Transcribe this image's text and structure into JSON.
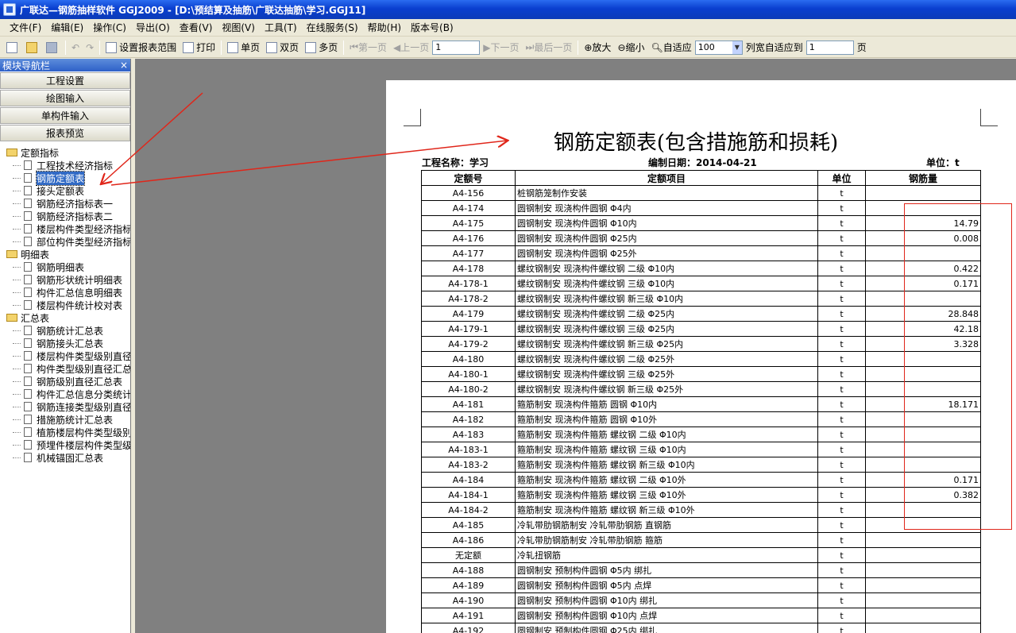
{
  "window": {
    "title": "广联达—钢筋抽样软件 GGJ2009 - [D:\\预结算及抽筋\\广联达抽筋\\学习.GGJ11]"
  },
  "menu": [
    "文件(F)",
    "编辑(E)",
    "操作(C)",
    "导出(O)",
    "查看(V)",
    "视图(V)",
    "工具(T)",
    "在线服务(S)",
    "帮助(H)",
    "版本号(B)"
  ],
  "toolbar": {
    "set_range": "设置报表范围",
    "print": "打印",
    "single_page": "单页",
    "double_page": "双页",
    "multi_page": "多页",
    "first_page": "第一页",
    "prev_page": "上一页",
    "page_value": "1",
    "next_page": "下一页",
    "last_page": "最后一页",
    "zoom_in": "放大",
    "zoom_out": "缩小",
    "fit": "自适应",
    "zoom_value": "100",
    "col_fit": "列宽自适应到",
    "col_fit_value": "1",
    "page_unit": "页"
  },
  "nav": {
    "header": "模块导航栏",
    "close": "×",
    "buttons": [
      "工程设置",
      "绘图输入",
      "单构件输入",
      "报表预览"
    ],
    "folders": [
      {
        "label": "定额指标",
        "items": [
          "工程技术经济指标",
          "钢筋定额表",
          "接头定额表",
          "钢筋经济指标表一",
          "钢筋经济指标表二",
          "楼层构件类型经济指标",
          "部位构件类型经济指标"
        ]
      },
      {
        "label": "明细表",
        "items": [
          "钢筋明细表",
          "钢筋形状统计明细表",
          "构件汇总信息明细表",
          "楼层构件统计校对表"
        ]
      },
      {
        "label": "汇总表",
        "items": [
          "钢筋统计汇总表",
          "钢筋接头汇总表",
          "楼层构件类型级别直径",
          "构件类型级别直径汇总",
          "钢筋级别直径汇总表",
          "构件汇总信息分类统计",
          "钢筋连接类型级别直径",
          "措施筋统计汇总表",
          "植筋楼层构件类型级别",
          "预埋件楼层构件类型级",
          "机械锚固汇总表"
        ]
      }
    ]
  },
  "report": {
    "title": "钢筋定额表(包含措施筋和损耗)",
    "project": "工程名称：学习",
    "date": "编制日期：2014-04-21",
    "unit": "单位：t",
    "headers": [
      "定额号",
      "定额项目",
      "单位",
      "钢筋量"
    ],
    "rows": [
      [
        "A4-156",
        "桩钢筋笼制作安装",
        "t",
        ""
      ],
      [
        "A4-174",
        "圆钢制安 现浇构件圆钢 Φ4内",
        "t",
        ""
      ],
      [
        "A4-175",
        "圆钢制安 现浇构件圆钢 Φ10内",
        "t",
        "14.79"
      ],
      [
        "A4-176",
        "圆钢制安 现浇构件圆钢 Φ25内",
        "t",
        "0.008"
      ],
      [
        "A4-177",
        "圆钢制安 现浇构件圆钢 Φ25外",
        "t",
        ""
      ],
      [
        "A4-178",
        "螺纹钢制安 现浇构件螺纹钢 二级 Φ10内",
        "t",
        "0.422"
      ],
      [
        "A4-178-1",
        "螺纹钢制安 现浇构件螺纹钢 三级 Φ10内",
        "t",
        "0.171"
      ],
      [
        "A4-178-2",
        "螺纹钢制安 现浇构件螺纹钢 新三级 Φ10内",
        "t",
        ""
      ],
      [
        "A4-179",
        "螺纹钢制安 现浇构件螺纹钢 二级 Φ25内",
        "t",
        "28.848"
      ],
      [
        "A4-179-1",
        "螺纹钢制安 现浇构件螺纹钢 三级 Φ25内",
        "t",
        "42.18"
      ],
      [
        "A4-179-2",
        "螺纹钢制安 现浇构件螺纹钢 新三级 Φ25内",
        "t",
        "3.328"
      ],
      [
        "A4-180",
        "螺纹钢制安 现浇构件螺纹钢 二级 Φ25外",
        "t",
        ""
      ],
      [
        "A4-180-1",
        "螺纹钢制安 现浇构件螺纹钢 三级 Φ25外",
        "t",
        ""
      ],
      [
        "A4-180-2",
        "螺纹钢制安 现浇构件螺纹钢 新三级 Φ25外",
        "t",
        ""
      ],
      [
        "A4-181",
        "箍筋制安 现浇构件箍筋 圆钢 Φ10内",
        "t",
        "18.171"
      ],
      [
        "A4-182",
        "箍筋制安 现浇构件箍筋 圆钢 Φ10外",
        "t",
        ""
      ],
      [
        "A4-183",
        "箍筋制安 现浇构件箍筋 螺纹钢 二级 Φ10内",
        "t",
        ""
      ],
      [
        "A4-183-1",
        "箍筋制安 现浇构件箍筋 螺纹钢  三级 Φ10内",
        "t",
        ""
      ],
      [
        "A4-183-2",
        "箍筋制安 现浇构件箍筋 螺纹钢  新三级 Φ10内",
        "t",
        ""
      ],
      [
        "A4-184",
        "箍筋制安 现浇构件箍筋 螺纹钢 二级 Φ10外",
        "t",
        "0.171"
      ],
      [
        "A4-184-1",
        "箍筋制安 现浇构件箍筋 螺纹钢 三级 Φ10外",
        "t",
        "0.382"
      ],
      [
        "A4-184-2",
        "箍筋制安 现浇构件箍筋 螺纹钢 新三级 Φ10外",
        "t",
        ""
      ],
      [
        "A4-185",
        "冷轧带肋钢筋制安 冷轧带肋钢筋 直钢筋",
        "t",
        ""
      ],
      [
        "A4-186",
        "冷轧带肋钢筋制安 冷轧带肋钢筋 箍筋",
        "t",
        ""
      ],
      [
        "无定额",
        "冷轧扭钢筋",
        "t",
        ""
      ],
      [
        "A4-188",
        "圆钢制安 预制构件圆钢 Φ5内 绑扎",
        "t",
        ""
      ],
      [
        "A4-189",
        "圆钢制安 预制构件圆钢 Φ5内 点焊",
        "t",
        ""
      ],
      [
        "A4-190",
        "圆钢制安 预制构件圆钢 Φ10内 绑扎",
        "t",
        ""
      ],
      [
        "A4-191",
        "圆钢制安 预制构件圆钢 Φ10内 点焊",
        "t",
        ""
      ],
      [
        "A4-192",
        "圆钢制安 预制构件圆钢 Φ25内 绑扎",
        "t",
        ""
      ]
    ]
  },
  "colors": {
    "annotation": "#e0261a",
    "title_bar": "#0a3fcf",
    "selection": "#316ac5"
  }
}
